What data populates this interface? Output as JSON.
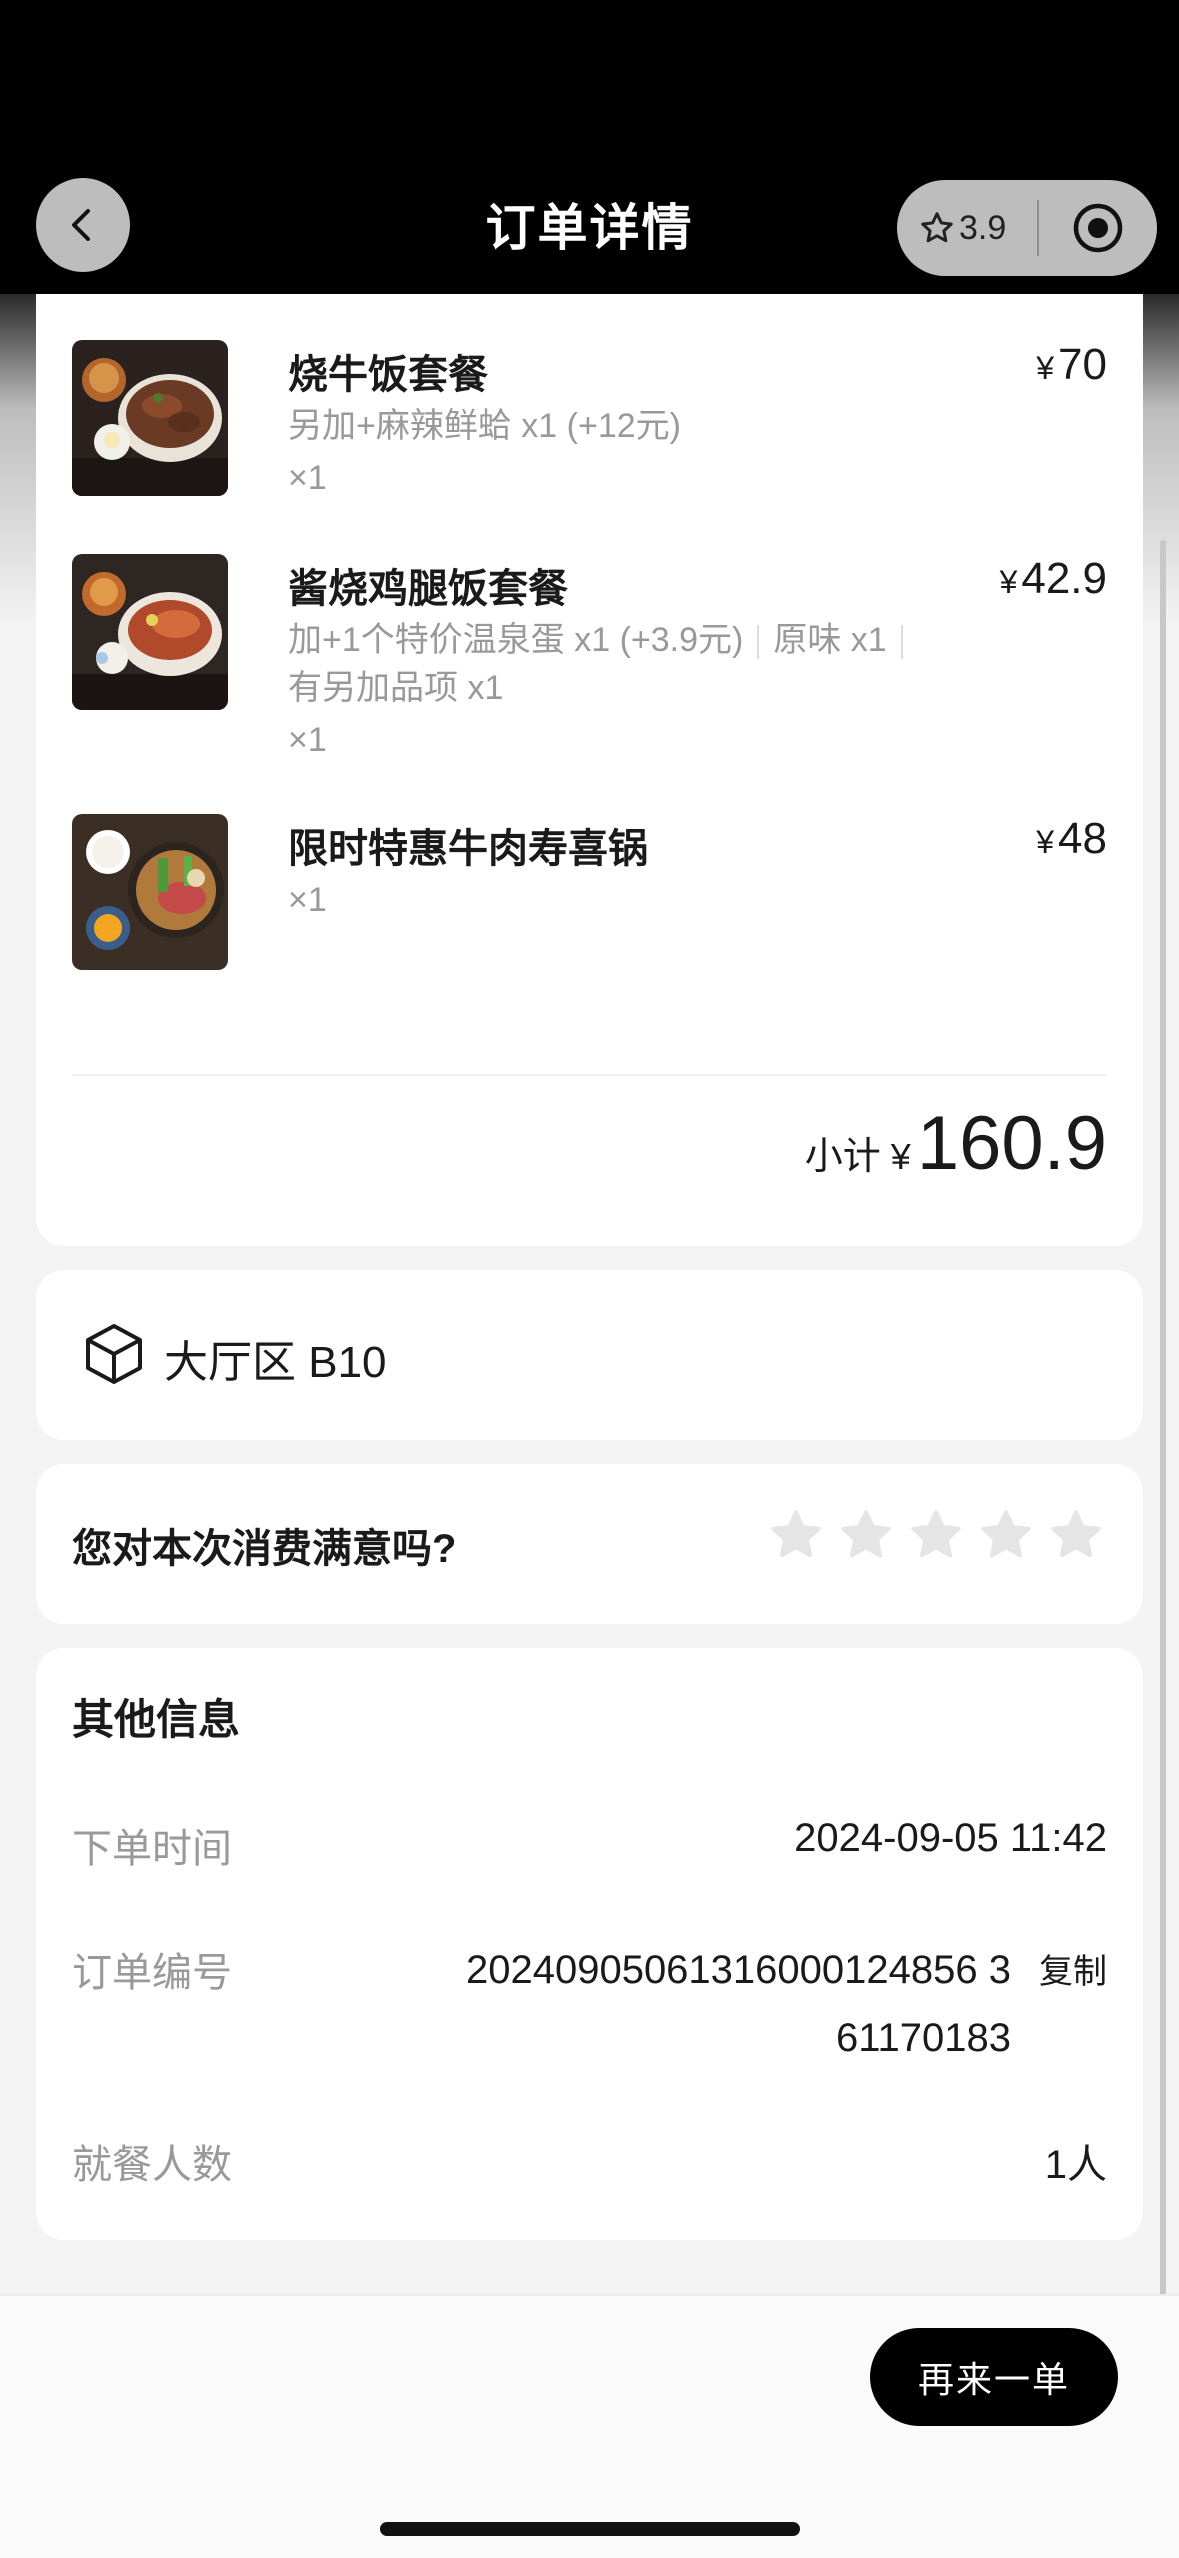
{
  "header": {
    "title": "订单详情",
    "rating": "3.9",
    "back_icon": "chevron-left-icon",
    "star_icon": "star-outline-icon",
    "target_icon": "target-icon"
  },
  "items": [
    {
      "name": "烧牛饭套餐",
      "price_symbol": "¥",
      "price": "70",
      "desc_lines": [
        "另加+麻辣鲜蛤 x1 (+12元)"
      ],
      "qty": "×1"
    },
    {
      "name": "酱烧鸡腿饭套餐",
      "price_symbol": "¥",
      "price": "42.9",
      "desc_part1": "加+1个特价温泉蛋 x1 (+3.9元)",
      "desc_part2": "原味 x1",
      "desc_line2": "有另加品项 x1",
      "qty": "×1"
    },
    {
      "name": "限时特惠牛肉寿喜锅",
      "price_symbol": "¥",
      "price": "48",
      "qty": "×1"
    }
  ],
  "subtotal": {
    "label": "小计",
    "symbol": "¥",
    "value": "160.9"
  },
  "table": {
    "text": "大厅区 B10",
    "icon": "cube-icon"
  },
  "rating_prompt": {
    "question": "您对本次消费满意吗?",
    "stars_filled": 0,
    "stars_total": 5
  },
  "info": {
    "title": "其他信息",
    "order_time_label": "下单时间",
    "order_time": "2024-09-05 11:42",
    "order_no_label": "订单编号",
    "order_no": "2024090506131600012485 6361170183",
    "order_no_line1": "20240905061316000124856 3",
    "order_no_line2": "61170183",
    "copy_label": "复制",
    "diners_label": "就餐人数",
    "diners": "1人"
  },
  "footer": {
    "reorder_label": "再来一单"
  }
}
